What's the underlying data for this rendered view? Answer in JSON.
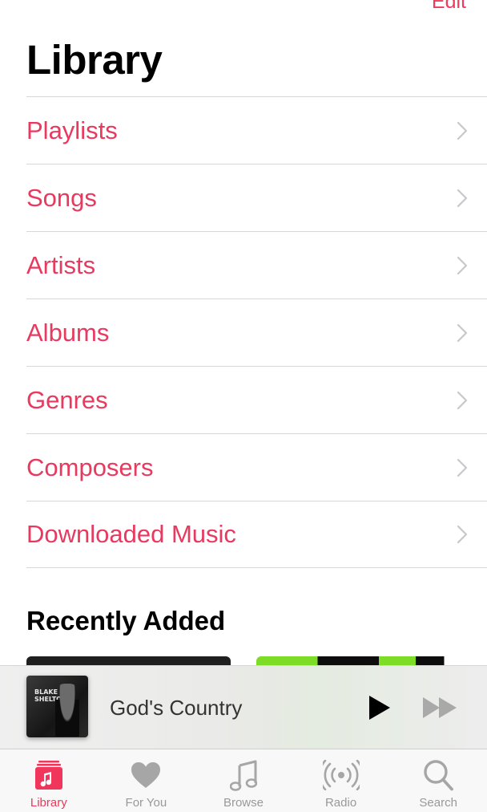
{
  "header": {
    "edit_label": "Edit",
    "title": "Library"
  },
  "library": {
    "items": [
      {
        "label": "Playlists"
      },
      {
        "label": "Songs"
      },
      {
        "label": "Artists"
      },
      {
        "label": "Albums"
      },
      {
        "label": "Genres"
      },
      {
        "label": "Composers"
      },
      {
        "label": "Downloaded Music"
      }
    ]
  },
  "recently_added": {
    "title": "Recently Added"
  },
  "mini_player": {
    "song_title": "God's Country",
    "artwork_text": "BLAKE SHELTON"
  },
  "tabbar": {
    "tabs": [
      {
        "label": "Library",
        "icon": "library-icon",
        "active": true
      },
      {
        "label": "For You",
        "icon": "heart-icon",
        "active": false
      },
      {
        "label": "Browse",
        "icon": "music-note-icon",
        "active": false
      },
      {
        "label": "Radio",
        "icon": "radio-icon",
        "active": false
      },
      {
        "label": "Search",
        "icon": "search-icon",
        "active": false
      }
    ]
  },
  "colors": {
    "accent": "#f0365a",
    "list_text": "#e8395f",
    "inactive_tab": "#999999"
  }
}
